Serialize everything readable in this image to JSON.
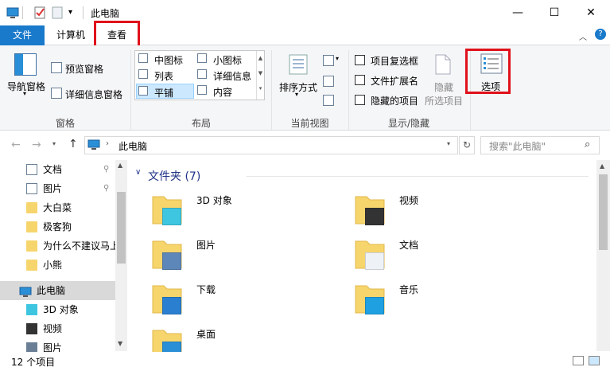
{
  "titlebar": {
    "title": "此电脑",
    "minimize": "—",
    "maximize": "☐",
    "close": "✕"
  },
  "tabs": {
    "file": "文件",
    "computer": "计算机",
    "view": "查看"
  },
  "ribbon": {
    "pane": {
      "nav_pane": "导航窗格",
      "preview_pane": "预览窗格",
      "details_pane": "详细信息窗格",
      "label": "窗格"
    },
    "layout": {
      "medium_icons": "中图标",
      "small_icons": "小图标",
      "list": "列表",
      "details": "详细信息",
      "tiles": "平铺",
      "content": "内容",
      "label": "布局"
    },
    "current_view": {
      "sort_by": "排序方式",
      "label": "当前视图"
    },
    "show_hide": {
      "item_checkboxes": "项目复选框",
      "file_extensions": "文件扩展名",
      "hidden_items": "隐藏的项目",
      "hide_selected_line1": "隐藏",
      "hide_selected_line2": "所选项目",
      "label": "显示/隐藏"
    },
    "options": {
      "label": "选项"
    }
  },
  "address": {
    "path": "此电脑",
    "search_placeholder": "搜索\"此电脑\""
  },
  "nav": {
    "quick_access": [
      {
        "label": "文档",
        "pinned": true
      },
      {
        "label": "图片",
        "pinned": true
      },
      {
        "label": "大白菜"
      },
      {
        "label": "极客狗"
      },
      {
        "label": "为什么不建议马上"
      },
      {
        "label": "小熊"
      }
    ],
    "this_pc": {
      "label": "此电脑"
    },
    "this_pc_children": [
      {
        "label": "3D 对象"
      },
      {
        "label": "视频"
      },
      {
        "label": "图片"
      }
    ]
  },
  "content": {
    "group_header": "文件夹 (7)",
    "folders": [
      {
        "label": "3D 对象"
      },
      {
        "label": "视频"
      },
      {
        "label": "图片"
      },
      {
        "label": "文档"
      },
      {
        "label": "下载"
      },
      {
        "label": "音乐"
      },
      {
        "label": "桌面"
      }
    ]
  },
  "status": {
    "count": "12 个项目"
  },
  "colors": {
    "accent": "#1979ca",
    "highlight_box": "#e0111b",
    "folder": "#f7d56d",
    "selected": "#cce8ff"
  }
}
